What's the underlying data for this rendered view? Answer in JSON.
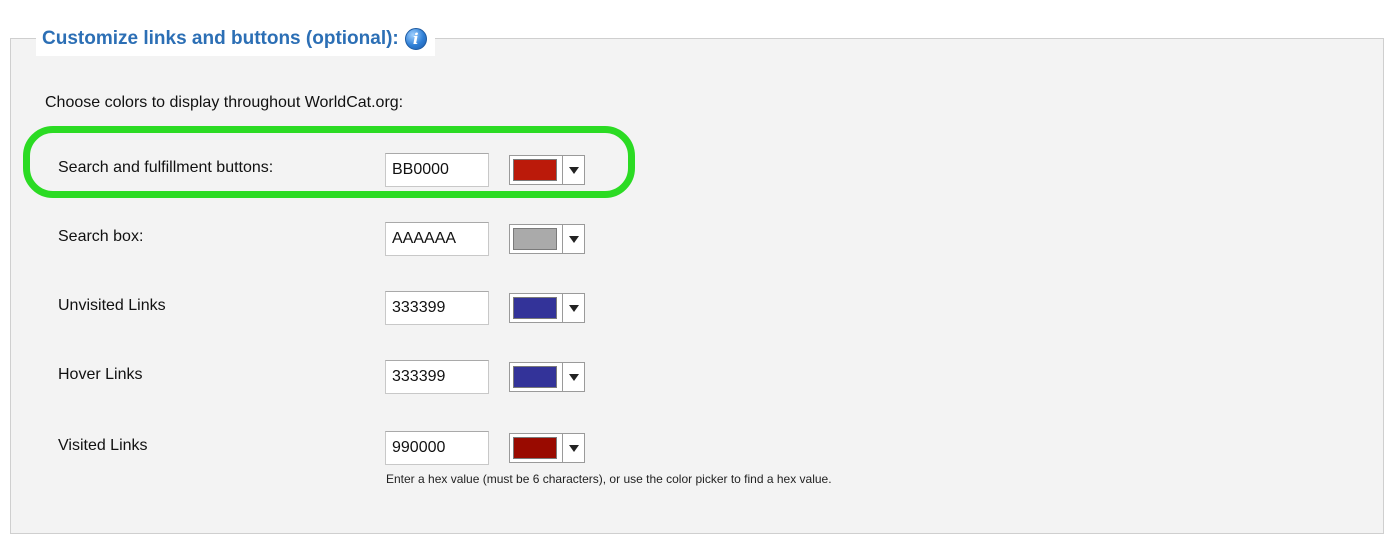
{
  "section": {
    "title": "Customize links and buttons (optional):",
    "info_icon": "info-icon"
  },
  "intro": "Choose colors to display throughout WorldCat.org:",
  "rows": [
    {
      "label": "Search and fulfillment buttons:",
      "hex": "BB0000",
      "swatch": "#bb1a0a",
      "highlighted": true
    },
    {
      "label": "Search box:",
      "hex": "AAAAAA",
      "swatch": "#aaaaaa"
    },
    {
      "label": "Unvisited Links",
      "hex": "333399",
      "swatch": "#333399"
    },
    {
      "label": "Hover Links",
      "hex": "333399",
      "swatch": "#333399"
    },
    {
      "label": "Visited Links",
      "hex": "990000",
      "swatch": "#990a00"
    }
  ],
  "helper_text": "Enter a hex value (must be 6 characters), or use the color picker to find a hex value.",
  "colors": {
    "legend": "#2c6fb5",
    "highlight": "#2bdb23",
    "panel": "#f3f3f3"
  }
}
